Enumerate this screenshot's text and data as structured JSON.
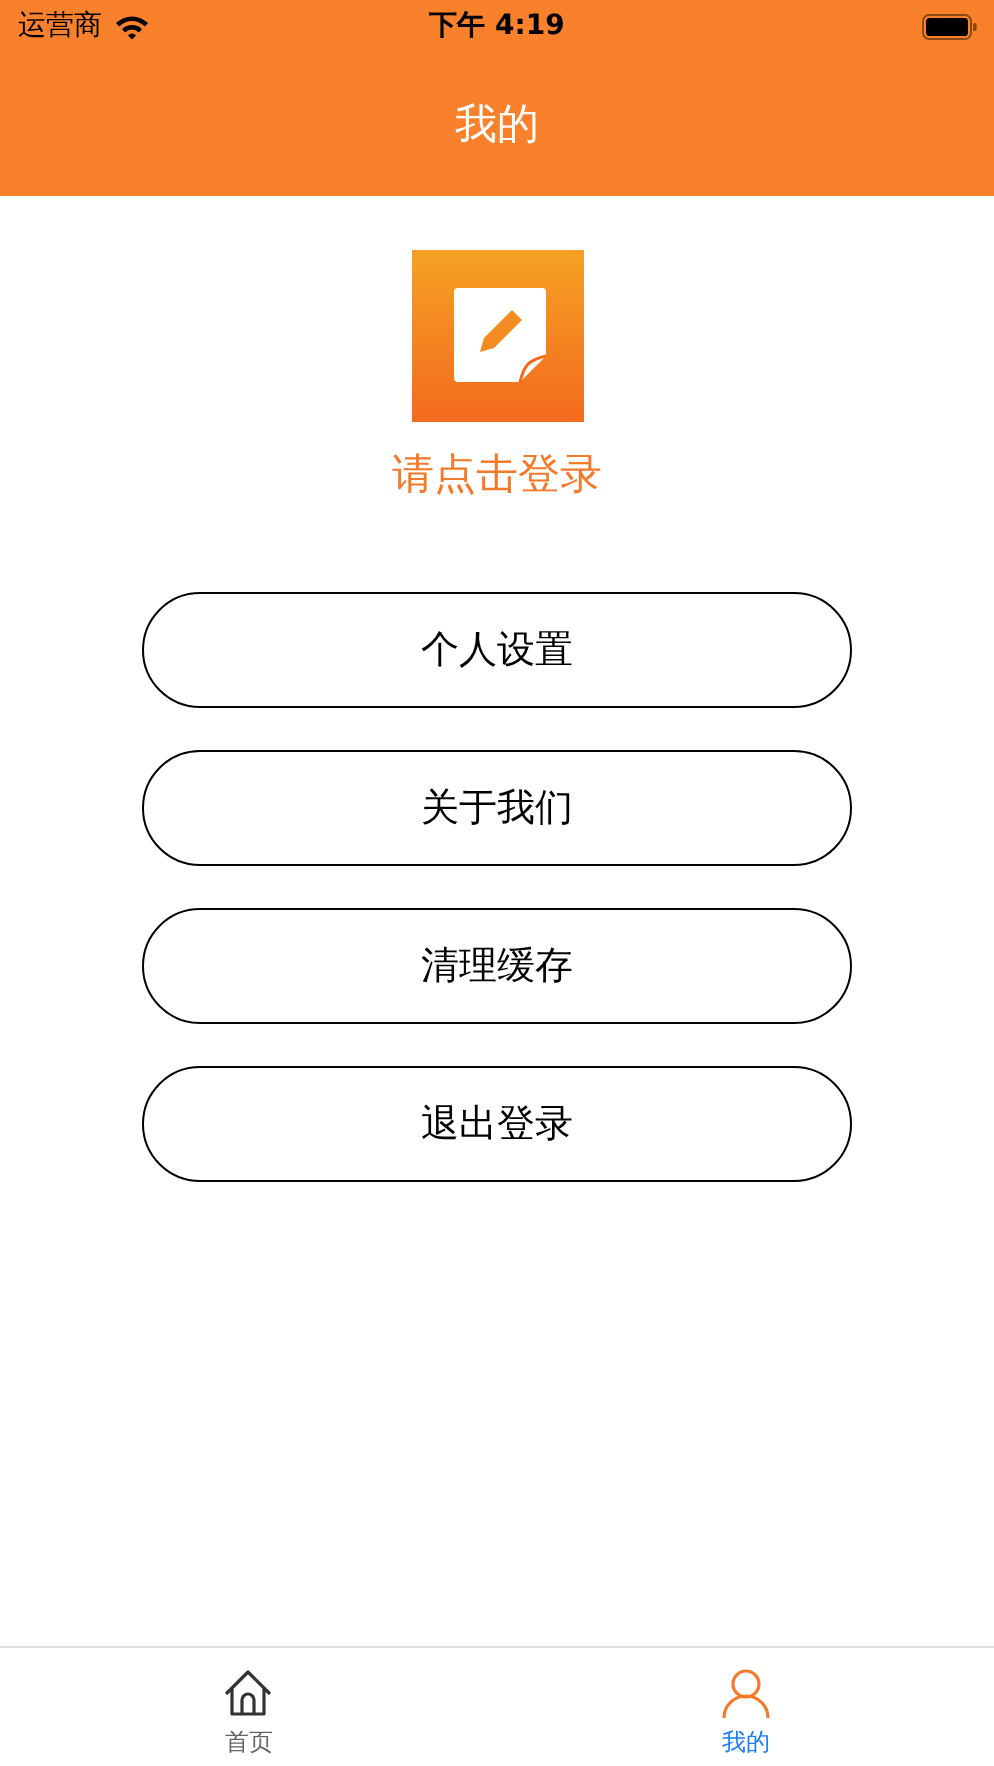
{
  "status_bar": {
    "carrier": "运营商",
    "time": "下午 4:19"
  },
  "nav": {
    "title": "我的"
  },
  "profile": {
    "login_prompt": "请点击登录"
  },
  "menu": [
    {
      "label": "个人设置"
    },
    {
      "label": "关于我们"
    },
    {
      "label": "清理缓存"
    },
    {
      "label": "退出登录"
    }
  ],
  "tab_bar": [
    {
      "label": "首页",
      "kind": "home",
      "selected": false
    },
    {
      "label": "我的",
      "kind": "person",
      "selected": true
    }
  ]
}
